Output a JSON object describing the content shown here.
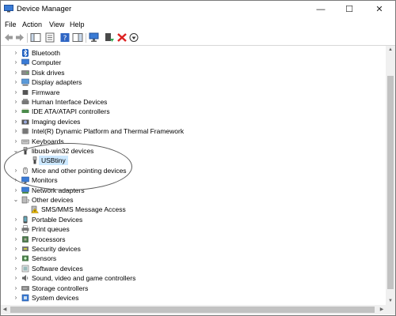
{
  "window": {
    "title": "Device Manager",
    "minimize_glyph": "—",
    "maximize_glyph": "☐",
    "close_glyph": "✕"
  },
  "menu": [
    "File",
    "Action",
    "View",
    "Help"
  ],
  "toolbar": [
    "back-icon",
    "forward-icon",
    "console-tree-icon",
    "properties-icon",
    "help-icon",
    "action-pane-icon",
    "scan-hardware-icon",
    "update-driver-icon",
    "uninstall-icon",
    "disable-icon"
  ],
  "tree": [
    {
      "label": "Bluetooth",
      "icon": "bluetooth-icon",
      "state": "collapsed",
      "level": 1
    },
    {
      "label": "Computer",
      "icon": "computer-icon",
      "state": "collapsed",
      "level": 1
    },
    {
      "label": "Disk drives",
      "icon": "disk-icon",
      "state": "collapsed",
      "level": 1
    },
    {
      "label": "Display adapters",
      "icon": "display-adapter-icon",
      "state": "collapsed",
      "level": 1
    },
    {
      "label": "Firmware",
      "icon": "firmware-icon",
      "state": "collapsed",
      "level": 1
    },
    {
      "label": "Human Interface Devices",
      "icon": "hid-icon",
      "state": "collapsed",
      "level": 1
    },
    {
      "label": "IDE ATA/ATAPI controllers",
      "icon": "ide-icon",
      "state": "collapsed",
      "level": 1
    },
    {
      "label": "Imaging devices",
      "icon": "camera-icon",
      "state": "collapsed",
      "level": 1
    },
    {
      "label": "Intel(R) Dynamic Platform and Thermal Framework",
      "icon": "thermal-icon",
      "state": "collapsed",
      "level": 1
    },
    {
      "label": "Keyboards",
      "icon": "keyboard-icon",
      "state": "collapsed",
      "level": 1
    },
    {
      "label": "libusb-win32 devices",
      "icon": "usb-icon",
      "state": "expanded",
      "level": 1
    },
    {
      "label": "USBtiny",
      "icon": "usb-icon",
      "state": "leaf",
      "level": 2,
      "selected": true
    },
    {
      "label": "Mice and other pointing devices",
      "icon": "mouse-icon",
      "state": "collapsed",
      "level": 1
    },
    {
      "label": "Monitors",
      "icon": "monitor-icon",
      "state": "collapsed",
      "level": 1
    },
    {
      "label": "Network adapters",
      "icon": "network-icon",
      "state": "collapsed",
      "level": 1
    },
    {
      "label": "Other devices",
      "icon": "other-devices-icon",
      "state": "expanded",
      "level": 1
    },
    {
      "label": "SMS/MMS Message Access",
      "icon": "unknown-device-warning-icon",
      "state": "leaf",
      "level": 2
    },
    {
      "label": "Portable Devices",
      "icon": "portable-device-icon",
      "state": "collapsed",
      "level": 1
    },
    {
      "label": "Print queues",
      "icon": "printer-icon",
      "state": "collapsed",
      "level": 1
    },
    {
      "label": "Processors",
      "icon": "processor-icon",
      "state": "collapsed",
      "level": 1
    },
    {
      "label": "Security devices",
      "icon": "security-icon",
      "state": "collapsed",
      "level": 1
    },
    {
      "label": "Sensors",
      "icon": "sensor-icon",
      "state": "collapsed",
      "level": 1
    },
    {
      "label": "Software devices",
      "icon": "software-device-icon",
      "state": "collapsed",
      "level": 1
    },
    {
      "label": "Sound, video and game controllers",
      "icon": "sound-icon",
      "state": "collapsed",
      "level": 1
    },
    {
      "label": "Storage controllers",
      "icon": "storage-icon",
      "state": "collapsed",
      "level": 1
    },
    {
      "label": "System devices",
      "icon": "system-icon",
      "state": "collapsed",
      "level": 1
    }
  ],
  "colors": {
    "selection": "#cce8ff",
    "annotation": "#5b5b5b"
  }
}
